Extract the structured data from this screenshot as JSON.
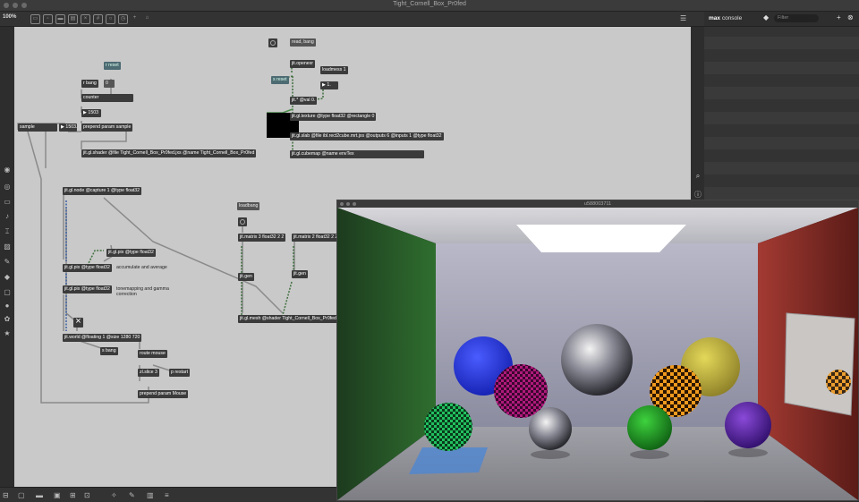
{
  "window": {
    "title": "Tight_Cornell_Box_Pr0fed"
  },
  "toolbar": {
    "zoom": "100%"
  },
  "console": {
    "title_bold": "max",
    "title": "console",
    "filter_placeholder": "Filter"
  },
  "objects": {
    "r_reset": "r reset",
    "r_bang": "r bang",
    "zero": "0",
    "counter": "counter",
    "num_1503": "▶ 1503",
    "sample_menu": "sample",
    "num_1503b": "▶ 1503.",
    "prepend_sample": "prepend param sample",
    "shader": "jit.gl.shader @file Tight_Cornell_Box_Pr0fed.jxs @name Tight_Cornell_Box_Pr0fed",
    "read_bang": "read, bang",
    "openexr": "jit.openexr",
    "s_reset": "s reset",
    "loadmess": "loadmess 1",
    "num_1": "▶ 1.",
    "jit_mult": "jit.* @val 0.",
    "gl_texture": "jit.gl.texture @type float32 @rectangle 0",
    "gl_slab": "jit.gl.slab @file ibl.rect2cube.mrt.jxs @outputs 6 @inputs 1 @type float32",
    "cubemap": "jit.gl.cubemap @name envTex",
    "gl_node": "jit.gl.node @capture 1 @type float32",
    "pix1": "jit.gl.pix @type float32",
    "pix2": "jit.gl.pix @type float32",
    "pix3": "jit.gl.pix @type float32",
    "world": "jit.world @floating 1 @size 1280 720",
    "s_bang": "s bang",
    "route_mouse": "route mouse",
    "zl_slice": "zl.slice 3",
    "p_restart": "p restart",
    "prepend_mouse": "prepend param Mouse",
    "loadbang": "loadbang",
    "matrix3": "jit.matrix 3 float32 2 2",
    "matrix2": "jit.matrix 2 float32 2 2",
    "gen1": "jit.gen",
    "gen2": "jit.gen",
    "mesh": "jit.gl.mesh @shader Tight_Cornell_Box_Pr0fed"
  },
  "comments": {
    "accumulate": "accumulate and average",
    "tonemap": "tonemapping and gamma correction"
  },
  "render_window": {
    "title": "u588003711"
  },
  "colors": {
    "patcher_bg": "#c9c9c9",
    "object_bg": "#3b3b3b",
    "send_bg": "#4c6b72"
  },
  "icons": [
    "patcher-lock-icon",
    "presentation-icon",
    "grid-icon",
    "console-list-icon",
    "search-icon",
    "add-icon",
    "close-icon"
  ]
}
